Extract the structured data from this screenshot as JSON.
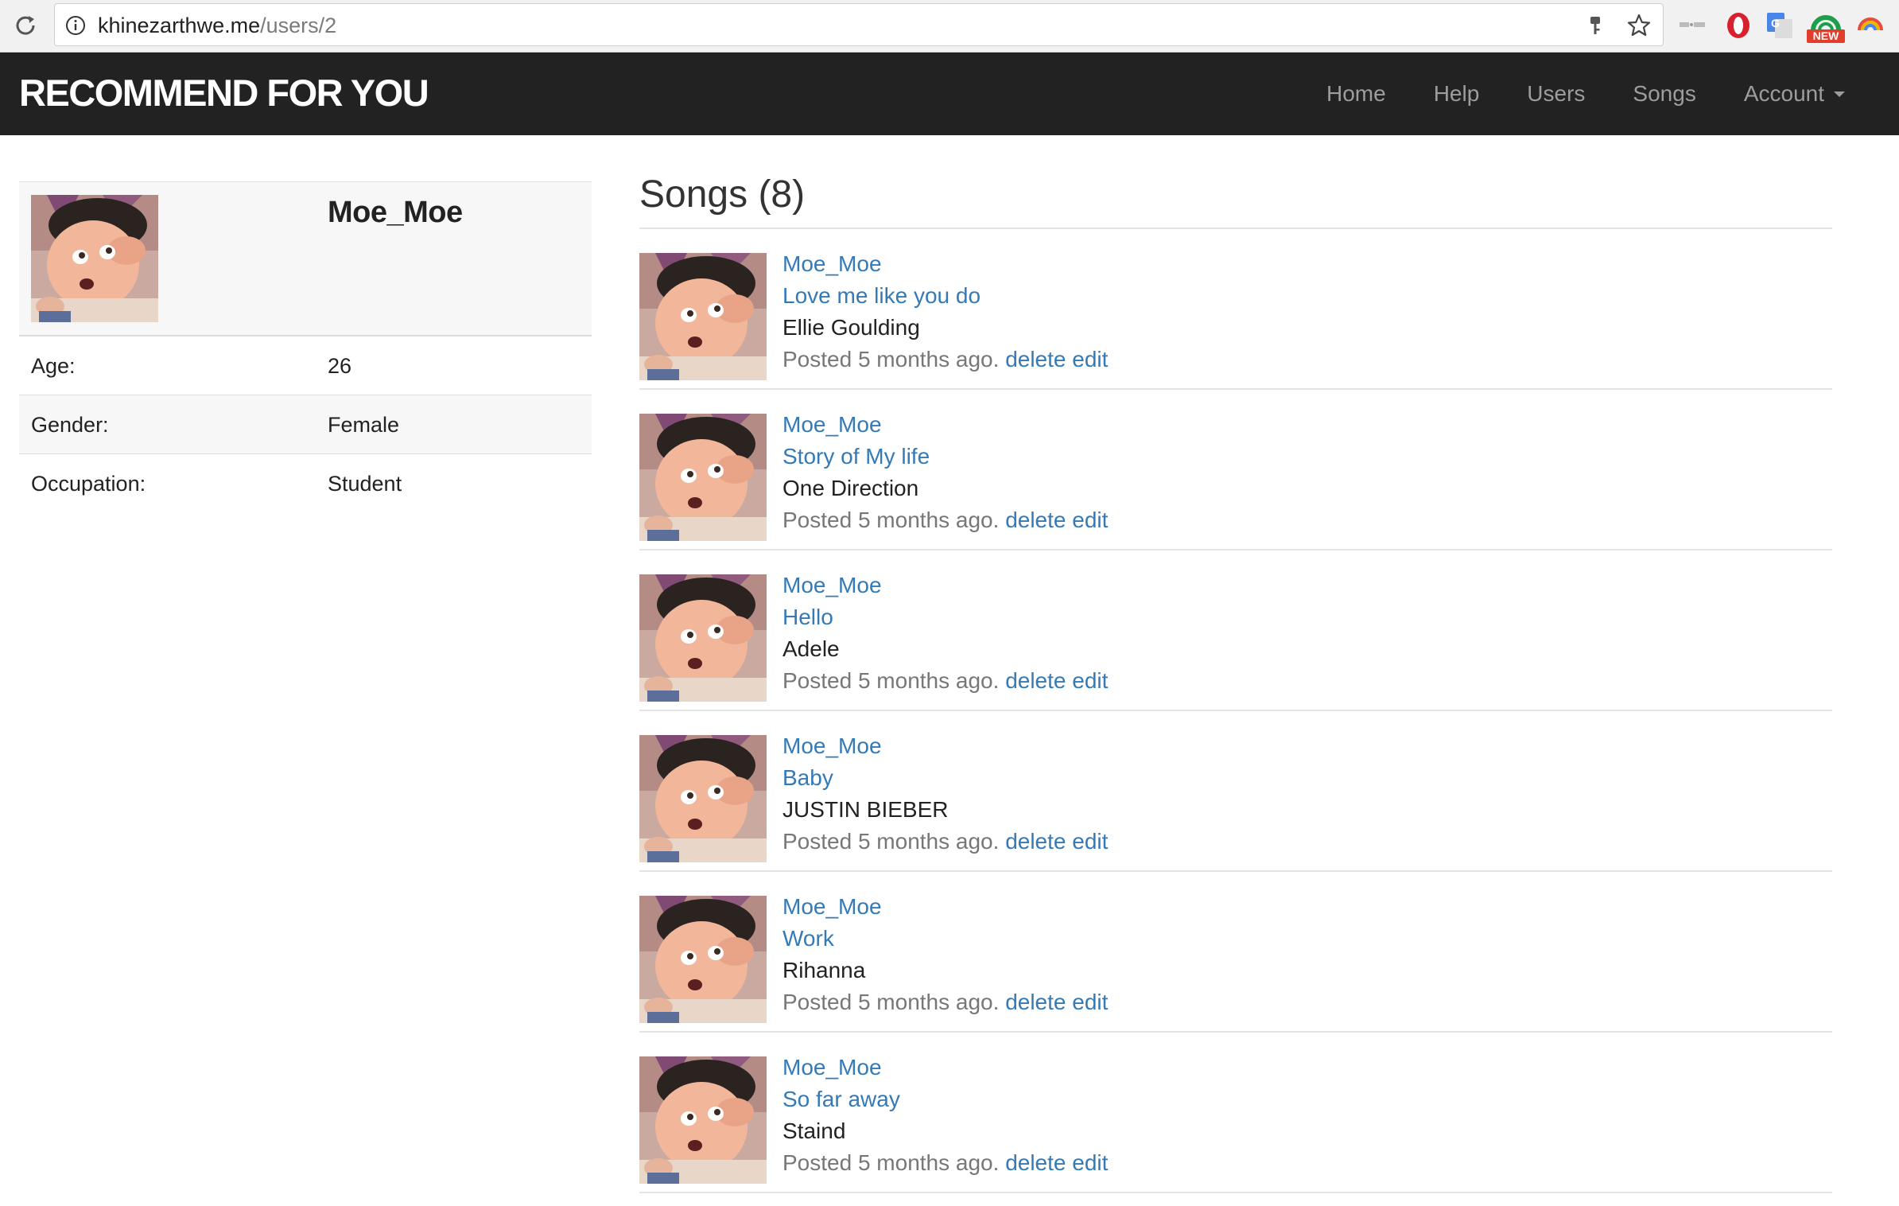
{
  "browser": {
    "url_host": "khinezarthwe.me",
    "url_path": "/users/2",
    "extension_badge": "NEW"
  },
  "navbar": {
    "brand": "RECOMMEND FOR YOU",
    "items": [
      {
        "label": "Home"
      },
      {
        "label": "Help"
      },
      {
        "label": "Users"
      },
      {
        "label": "Songs"
      },
      {
        "label": "Account"
      }
    ]
  },
  "profile": {
    "name": "Moe_Moe",
    "attributes": [
      {
        "label": "Age:",
        "value": "26"
      },
      {
        "label": "Gender:",
        "value": "Female"
      },
      {
        "label": "Occupation:",
        "value": "Student"
      }
    ]
  },
  "songs": {
    "heading": "Songs (8)",
    "items": [
      {
        "user": "Moe_Moe",
        "title": "Love me like you do",
        "artist": "Ellie Goulding",
        "posted": "Posted 5 months ago.",
        "delete": "delete",
        "edit": "edit"
      },
      {
        "user": "Moe_Moe",
        "title": "Story of My life",
        "artist": "One Direction",
        "posted": "Posted 5 months ago.",
        "delete": "delete",
        "edit": "edit"
      },
      {
        "user": "Moe_Moe",
        "title": "Hello",
        "artist": "Adele",
        "posted": "Posted 5 months ago.",
        "delete": "delete",
        "edit": "edit"
      },
      {
        "user": "Moe_Moe",
        "title": "Baby",
        "artist": "JUSTIN BIEBER",
        "posted": "Posted 5 months ago.",
        "delete": "delete",
        "edit": "edit"
      },
      {
        "user": "Moe_Moe",
        "title": "Work",
        "artist": "Rihanna",
        "posted": "Posted 5 months ago.",
        "delete": "delete",
        "edit": "edit"
      },
      {
        "user": "Moe_Moe",
        "title": "So far away",
        "artist": "Staind",
        "posted": "Posted 5 months ago.",
        "delete": "delete",
        "edit": "edit"
      }
    ]
  },
  "colors": {
    "navbar_bg": "#222222",
    "nav_text": "#9d9d9d",
    "link": "#337ab7",
    "muted": "#777777"
  }
}
